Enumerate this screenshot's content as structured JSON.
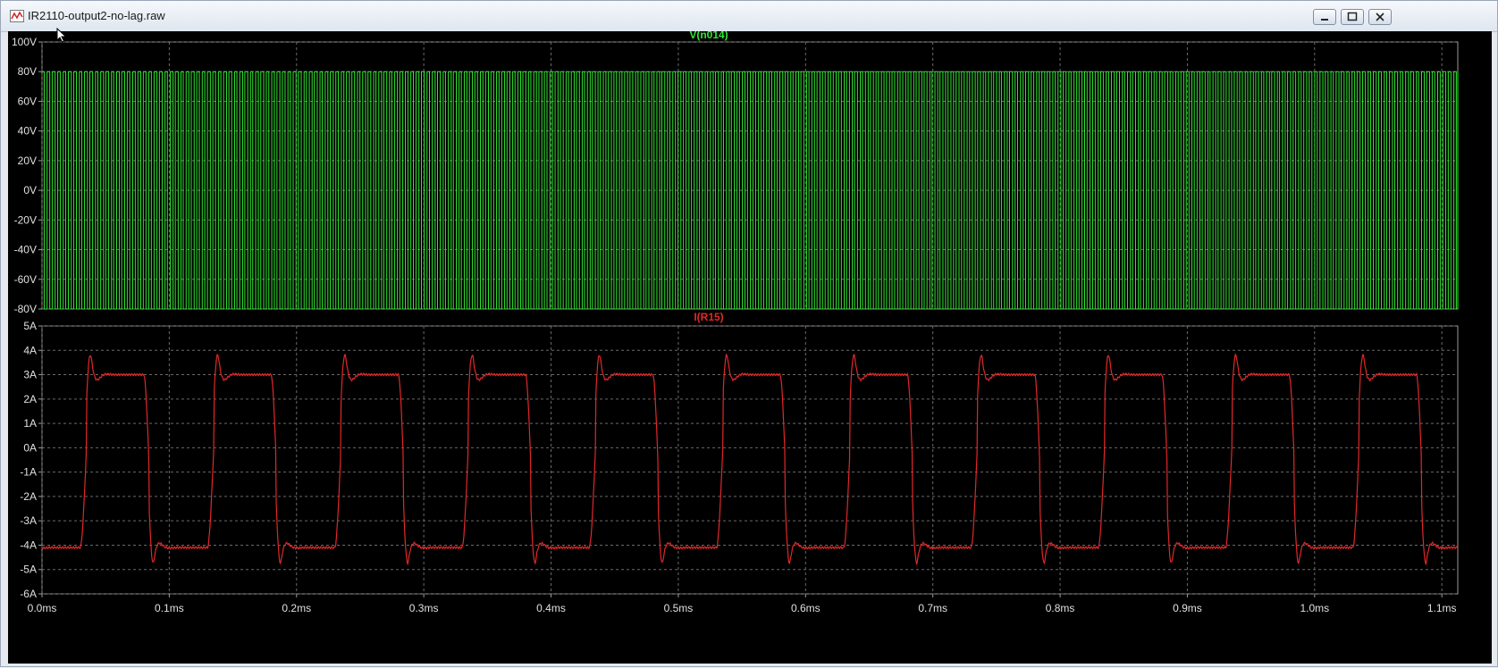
{
  "window": {
    "title": "IR2110-output2-no-lag.raw",
    "icon": "waveform-icon",
    "controls": {
      "minimize": "minimize-icon",
      "maximize": "maximize-icon",
      "close": "close-icon"
    }
  },
  "colors": {
    "background": "#000000",
    "grid": "#6a6a6a",
    "axis_text": "#e0e0e0",
    "voltage_trace": "#33e833",
    "current_trace": "#e02828",
    "frame": "#9a9a9a"
  },
  "chart_data": [
    {
      "type": "line",
      "title": "V(n014)",
      "ylabel": "",
      "xlabel": "",
      "xlim": [
        0,
        1.1125
      ],
      "ylim": [
        -80,
        100
      ],
      "x_unit": "ms",
      "y_unit": "V",
      "grid": true,
      "y_ticks": [
        "100V",
        "80V",
        "60V",
        "40V",
        "20V",
        "0V",
        "-20V",
        "-40V",
        "-60V",
        "-80V"
      ],
      "y_tick_values": [
        100,
        80,
        60,
        40,
        20,
        0,
        -20,
        -40,
        -60,
        -80
      ],
      "waveform": {
        "kind": "square",
        "high": 80,
        "low": -80,
        "period_ms": 0.004
      },
      "series": [
        {
          "name": "V(n014)"
        }
      ]
    },
    {
      "type": "line",
      "title": "I(R15)",
      "ylabel": "",
      "xlabel": "",
      "xlim": [
        0,
        1.1125
      ],
      "ylim": [
        -6,
        5
      ],
      "x_unit": "ms",
      "y_unit": "A",
      "grid": true,
      "y_ticks": [
        "5A",
        "4A",
        "3A",
        "2A",
        "1A",
        "0A",
        "-1A",
        "-2A",
        "-3A",
        "-4A",
        "-5A",
        "-6A"
      ],
      "y_tick_values": [
        5,
        4,
        3,
        2,
        1,
        0,
        -1,
        -2,
        -3,
        -4,
        -5,
        -6
      ],
      "x_ticks": [
        "0.0ms",
        "0.1ms",
        "0.2ms",
        "0.3ms",
        "0.4ms",
        "0.5ms",
        "0.6ms",
        "0.7ms",
        "0.8ms",
        "0.9ms",
        "1.0ms",
        "1.1ms"
      ],
      "x_tick_values": [
        0,
        0.1,
        0.2,
        0.3,
        0.4,
        0.5,
        0.6,
        0.7,
        0.8,
        0.9,
        1.0,
        1.1
      ],
      "waveform": {
        "kind": "ringing-square",
        "period_ms": 0.1,
        "positive_peak": 4.5,
        "positive_plateau": 3.0,
        "negative_peak": -5.4,
        "negative_plateau": -4.1
      },
      "series": [
        {
          "name": "I(R15)"
        }
      ]
    }
  ]
}
